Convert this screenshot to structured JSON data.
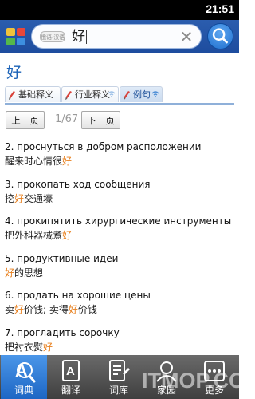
{
  "status_bar": {
    "time": "21:51"
  },
  "search": {
    "lang_chip": "俄语·汉语",
    "query": "好"
  },
  "word": {
    "title": "好"
  },
  "tabs": [
    {
      "label": "基础释义"
    },
    {
      "label": "行业释义"
    },
    {
      "label": "例句",
      "active": true
    }
  ],
  "pager": {
    "prev_label": "上一页",
    "page_indicator": "1/67",
    "next_label": "下一页"
  },
  "examples": [
    {
      "ru": "2. проснуться в добром расположении",
      "zh_before": "醒来时心情很",
      "zh_hl": "好",
      "zh_after": ""
    },
    {
      "ru": "3. прокопать ход сообщения",
      "zh_before": "挖",
      "zh_hl": "好",
      "zh_after": "交通壕"
    },
    {
      "ru": "4. прокипятить хирургические инструменты",
      "zh_before": "把外科器械煮",
      "zh_hl": "好",
      "zh_after": ""
    },
    {
      "ru": "5. продуктивные идеи",
      "zh_before": "",
      "zh_hl": "好",
      "zh_after": "的思想"
    },
    {
      "ru": "6. продать на хорошие цены",
      "zh_before": "卖",
      "zh_hl": "好",
      "zh_after": "价钱; 卖得",
      "zh_hl2": "好",
      "zh_after2": "价钱"
    },
    {
      "ru": "7. прогладить сорочку",
      "zh_before": "把衬衣熨",
      "zh_hl": "好",
      "zh_after": ""
    }
  ],
  "bottom_nav": [
    {
      "label": "词典",
      "icon": "dictionary-search-icon",
      "active": true
    },
    {
      "label": "翻译",
      "icon": "translate-icon"
    },
    {
      "label": "词库",
      "icon": "wordbank-icon"
    },
    {
      "label": "家园",
      "icon": "home-icon"
    },
    {
      "label": "更多",
      "icon": "more-icon"
    }
  ],
  "watermark": "ITMOP.COM",
  "colors": {
    "header": "#1d4c9e",
    "accent": "#1c63b8",
    "highlight": "#e8801f",
    "nav_active": "#1d66c4"
  }
}
